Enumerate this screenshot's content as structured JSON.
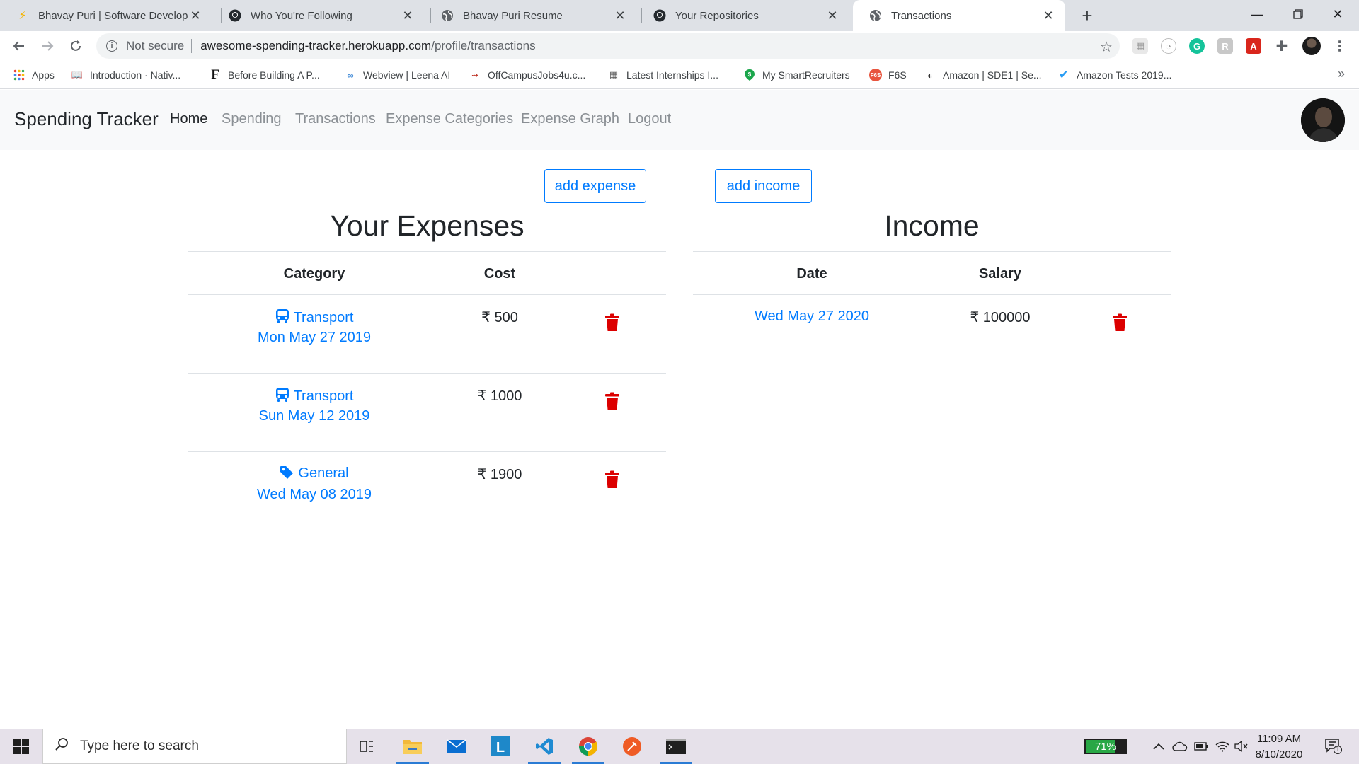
{
  "browser": {
    "tabs": [
      {
        "title": "Bhavay Puri | Software Developer",
        "icon": "lightning-icon"
      },
      {
        "title": "Who You're Following",
        "icon": "github-icon"
      },
      {
        "title": "Bhavay Puri Resume",
        "icon": "globe-icon"
      },
      {
        "title": "Your Repositories",
        "icon": "github-icon"
      },
      {
        "title": "Transactions",
        "icon": "globe-icon",
        "active": true
      }
    ],
    "address": {
      "security_label": "Not secure",
      "host": "awesome-spending-tracker.herokuapp.com",
      "path": "/profile/transactions"
    },
    "bookmarks": [
      {
        "label": "Apps",
        "icon": "apps-grid-icon"
      },
      {
        "label": "Introduction · Nativ...",
        "icon": "book-icon"
      },
      {
        "label": "Before Building A P...",
        "icon": "f-letter-icon"
      },
      {
        "label": "Webview | Leena AI",
        "icon": "leena-icon"
      },
      {
        "label": "OffCampusJobs4u.c...",
        "icon": "offcampus-icon"
      },
      {
        "label": "Latest Internships I...",
        "icon": "building-icon"
      },
      {
        "label": "My SmartRecruiters",
        "icon": "smartrecruiters-icon"
      },
      {
        "label": "F6S",
        "icon": "f6s-icon"
      },
      {
        "label": "Amazon | SDE1 | Se...",
        "icon": "amazon-icon"
      },
      {
        "label": "Amazon Tests 2019...",
        "icon": "check-icon"
      }
    ]
  },
  "app": {
    "brand": "Spending Tracker",
    "nav": [
      "Home",
      "Spending",
      "Transactions",
      "Expense Categories",
      "Expense Graph",
      "Logout"
    ],
    "active_nav": "Home",
    "add_expense_label": "add expense",
    "add_income_label": "add income",
    "expenses": {
      "title": "Your Expenses",
      "headers": [
        "Category",
        "Cost"
      ],
      "rows": [
        {
          "category": "Transport",
          "icon": "bus-icon",
          "date": "Mon May 27 2019",
          "cost": "₹ 500"
        },
        {
          "category": "Transport",
          "icon": "bus-icon",
          "date": "Sun May 12 2019",
          "cost": "₹ 1000"
        },
        {
          "category": "General",
          "icon": "tag-icon",
          "date": "Wed May 08 2019",
          "cost": "₹ 1900"
        }
      ]
    },
    "income": {
      "title": "Income",
      "headers": [
        "Date",
        "Salary"
      ],
      "rows": [
        {
          "date": "Wed May 27 2020",
          "salary": "₹ 100000"
        }
      ]
    },
    "colors": {
      "link": "#007bff",
      "delete": "#dc0000",
      "navbar_bg": "#f8f9fa"
    }
  },
  "taskbar": {
    "search_placeholder": "Type here to search",
    "battery": "71%",
    "battery_level": 0.71,
    "time": "11:09 AM",
    "date": "8/10/2020",
    "notifications": "1"
  }
}
